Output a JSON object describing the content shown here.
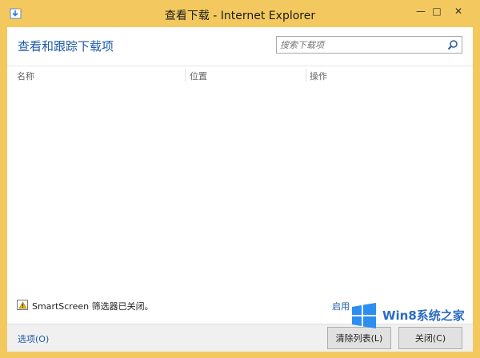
{
  "window": {
    "title": "查看下载 - Internet Explorer",
    "minimize_glyph": "—",
    "maximize_glyph": "□",
    "close_glyph": "✕"
  },
  "header": {
    "heading": "查看和跟踪下载项",
    "search_placeholder": "搜索下载项"
  },
  "table": {
    "columns": [
      "名称",
      "位置",
      "操作"
    ]
  },
  "smartscreen": {
    "message": "SmartScreen 筛选器已关闭。",
    "action_label": "启用"
  },
  "footer": {
    "options_label": "选项(O)",
    "clear_list_label": "清除列表(L)",
    "close_label": "关闭(C)"
  },
  "watermark": {
    "text": "Win8系统之家"
  },
  "colors": {
    "frame": "#f3c95f",
    "accent": "#1f5aa8",
    "watermark": "#2c6cc5"
  }
}
